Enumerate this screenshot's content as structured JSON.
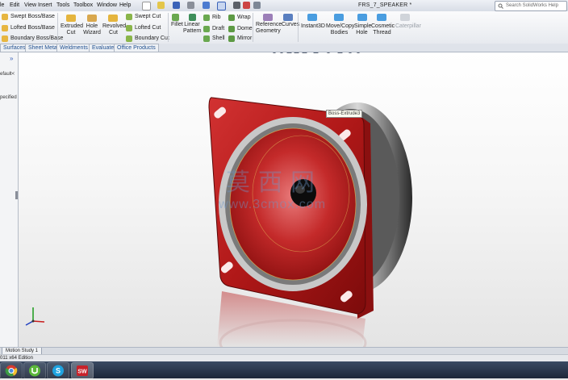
{
  "menu": {
    "items": [
      "le",
      "Edit",
      "View",
      "Insert",
      "Tools",
      "Toolbox",
      "Window",
      "Help"
    ]
  },
  "window": {
    "title": "FRS_7_SPEAKER *"
  },
  "search": {
    "placeholder": "Search SolidWorks Help"
  },
  "ribbon": {
    "boss_base": {
      "swept": "Swept Boss/Base",
      "lofted": "Lofted Boss/Base",
      "boundary": "Boundary Boss/Base"
    },
    "extruded_cut": {
      "line1": "Extruded",
      "line2": "Cut"
    },
    "hole_wizard": {
      "line1": "Hole",
      "line2": "Wizard"
    },
    "revolved_cut": {
      "line1": "Revolved",
      "line2": "Cut"
    },
    "cuts": {
      "swept": "Swept Cut",
      "lofted": "Lofted Cut",
      "boundary": "Boundary Cut"
    },
    "fillet": "Fillet",
    "linear_pattern": {
      "line1": "Linear",
      "line2": "Pattern"
    },
    "features": {
      "rib": "Rib",
      "draft": "Draft",
      "shell": "Shell",
      "wrap": "Wrap",
      "dome": "Dome",
      "mirror": "Mirror"
    },
    "reference_geometry": {
      "line1": "Reference",
      "line2": "Geometry"
    },
    "curves": "Curves",
    "instant3d": "Instant3D",
    "move_copy_bodies": {
      "line1": "Move/Copy",
      "line2": "Bodies"
    },
    "simple_hole": {
      "line1": "Simple",
      "line2": "Hole"
    },
    "cosmetic_thread": {
      "line1": "Cosmetic",
      "line2": "Thread"
    },
    "caterpillar": "Caterpillar"
  },
  "tabs": [
    "Surfaces",
    "Sheet Metal",
    "Weldments",
    "Evaluate",
    "Office Products"
  ],
  "left_panel": {
    "chevron": "»",
    "text1": "efault<",
    "text2": "pecified"
  },
  "viewport": {
    "tooltip": "Boss-Extrude3",
    "watermark_cn": "莫西网",
    "watermark_url": "www.3cmox.com"
  },
  "motion_tab": "Motion Study 1",
  "status": {
    "edition": "011 x64 Edition"
  },
  "colors": {
    "part_red": "#b01818",
    "accent_blue": "#1f4f8f"
  },
  "icons": [
    "chrome-icon",
    "utorrent-icon",
    "skype-icon",
    "solidworks-icon"
  ]
}
